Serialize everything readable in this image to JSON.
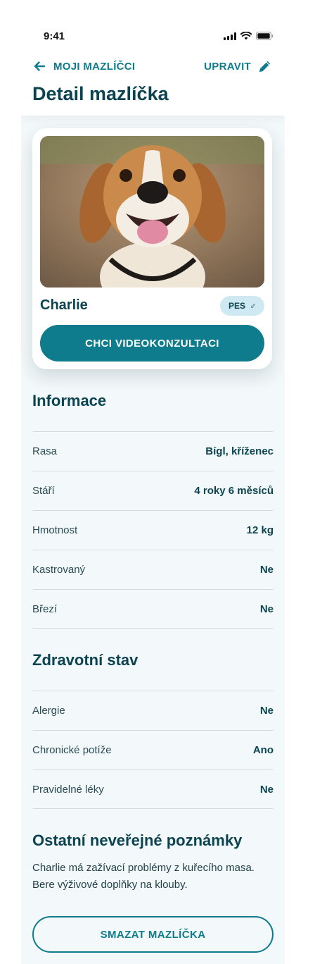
{
  "status_bar": {
    "time": "9:41"
  },
  "nav": {
    "back_label": "MOJI MAZLÍČCI",
    "edit_label": "UPRAVIT",
    "page_title": "Detail mazlíčka"
  },
  "pet": {
    "name": "Charlie",
    "species": "PES",
    "gender_symbol": "♂",
    "cta_label": "CHCI VIDEOKONZULTACI"
  },
  "info": {
    "title": "Informace",
    "rows": [
      {
        "label": "Rasa",
        "value": "Bígl, kříženec"
      },
      {
        "label": "Stáří",
        "value": "4 roky 6 měsíců"
      },
      {
        "label": "Hmotnost",
        "value": "12 kg"
      },
      {
        "label": "Kastrovaný",
        "value": "Ne"
      },
      {
        "label": "Březí",
        "value": "Ne"
      }
    ]
  },
  "health": {
    "title": "Zdravotní stav",
    "rows": [
      {
        "label": "Alergie",
        "value": "Ne"
      },
      {
        "label": "Chronické potíže",
        "value": "Ano"
      },
      {
        "label": "Pravidelné léky",
        "value": "Ne"
      }
    ]
  },
  "notes": {
    "title": "Ostatní neveřejné poznámky",
    "text": "Charlie má zažívací problémy z kuřecího masa. Bere výživové doplňky na klouby."
  },
  "delete_label": "SMAZAT MAZLÍČKA",
  "colors": {
    "accent": "#0e7c8c",
    "heading": "#0b4450",
    "badge": "#cfe9f3",
    "background": "#f3f8fa"
  },
  "icons": [
    "signal-icon",
    "wifi-icon",
    "battery-icon",
    "arrow-left-icon",
    "pencil-icon",
    "male-icon"
  ]
}
